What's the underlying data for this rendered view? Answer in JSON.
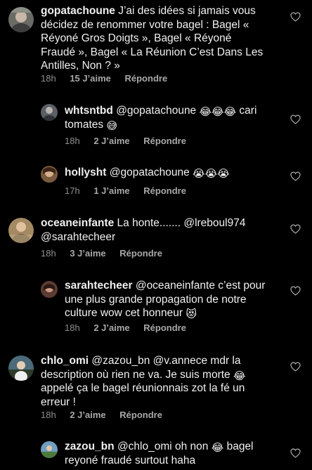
{
  "comments": [
    {
      "username": "gopatachoune",
      "text": "J’ai des idées si jamais vous décidez de renommer votre bagel : Bagel « Réyoné Gros Doigts », Bagel « Réyoné Fraudé », Bagel « La Réunion C’est Dans Les Antilles, Non ? »",
      "time": "18h",
      "likes": "15 J’aime",
      "reply": "Répondre"
    },
    {
      "username": "whtsntbd",
      "text_before": "@gopatachoune",
      "text_after": "cari tomates",
      "time": "18h",
      "likes": "2 J’aime",
      "reply": "Répondre"
    },
    {
      "username": "hollysht",
      "text": "@gopatachoune",
      "time": "17h",
      "likes": "1 J’aime",
      "reply": "Répondre"
    },
    {
      "username": "oceaneinfante",
      "text": "La honte....... @lreboul974 @sarahtecheer",
      "time": "18h",
      "likes": "3 J’aime",
      "reply": "Répondre"
    },
    {
      "username": "sarahtecheer",
      "text": "@oceaneinfante c’est pour une plus grande propagation de notre culture wow cet honneur",
      "time": "18h",
      "likes": "2 J’aime",
      "reply": "Répondre"
    },
    {
      "username": "chlo_omi",
      "text_before": "@zazou_bn @v.annece mdr la description où rien ne va. Je suis morte",
      "text_after": "appelé ça le bagel réunionnais zot la fé un erreur !",
      "time": "18h",
      "likes": "2 J’aime",
      "reply": "Répondre"
    },
    {
      "username": "zazou_bn",
      "text_before": "@chlo_omi oh non",
      "text_after": "bagel reyoné fraudé surtout haha"
    }
  ],
  "icons": {
    "like": "heart-outline-icon",
    "emoji_laugh": "face-with-tears-of-joy",
    "emoji_cry": "loudly-crying-face",
    "emoji_sweat": "grinning-face-with-sweat",
    "emoji_devil": "smiling-cat-with-heart-eyes"
  },
  "colors": {
    "background": "#000000",
    "text": "#f0f0f0",
    "secondary": "#a8a8a8"
  }
}
